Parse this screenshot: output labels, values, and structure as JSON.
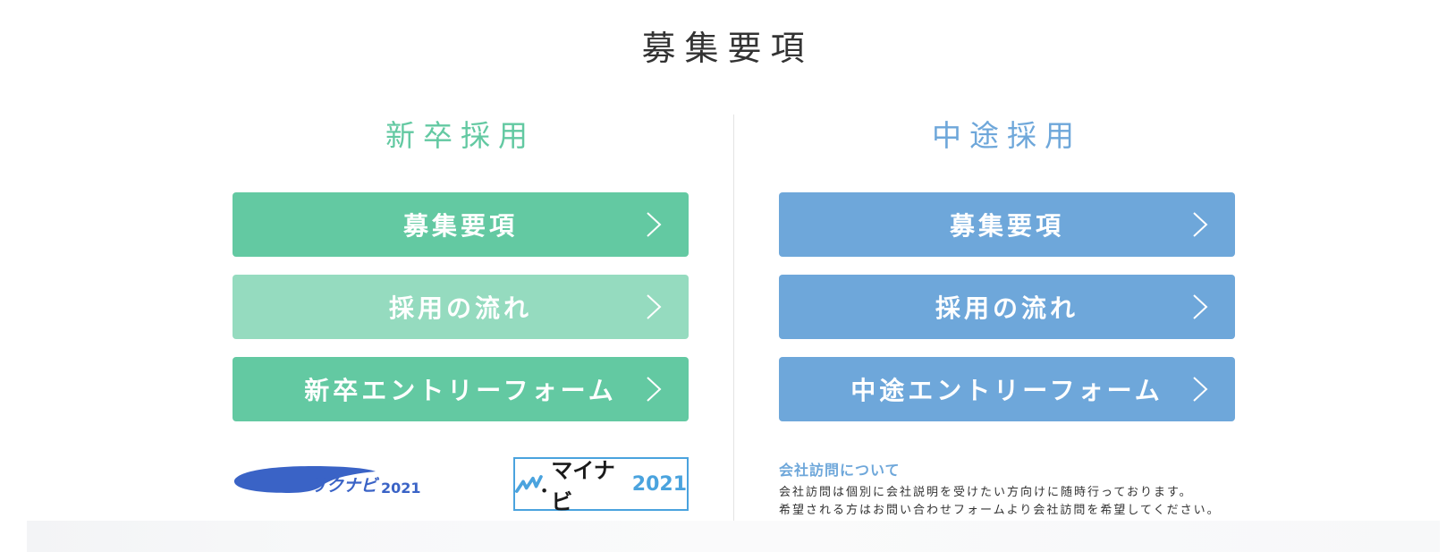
{
  "page": {
    "title": "募集要項"
  },
  "new_grad": {
    "heading": "新卒採用",
    "buttons": [
      {
        "label": "募集要項"
      },
      {
        "label": "採用の流れ"
      },
      {
        "label": "新卒エントリーフォーム"
      }
    ],
    "logos": {
      "rikunabi": {
        "text": "リクナビ",
        "year": "2021"
      },
      "mynavi": {
        "text": "マイナビ",
        "year": "2021"
      }
    }
  },
  "mid_career": {
    "heading": "中途採用",
    "buttons": [
      {
        "label": "募集要項"
      },
      {
        "label": "採用の流れ"
      },
      {
        "label": "中途エントリーフォーム"
      }
    ],
    "visit": {
      "title": "会社訪問について",
      "line1": "会社訪問は個別に会社説明を受けたい方向けに随時行っております。",
      "line2": "希望される方はお問い合わせフォームより会社訪問を希望してください。"
    }
  },
  "colors": {
    "green": "#63c9a2",
    "green_light": "#95dbbf",
    "blue": "#6ea7da",
    "text": "#333333"
  },
  "icons": {
    "button_arrow": "chevron-right-icon"
  }
}
